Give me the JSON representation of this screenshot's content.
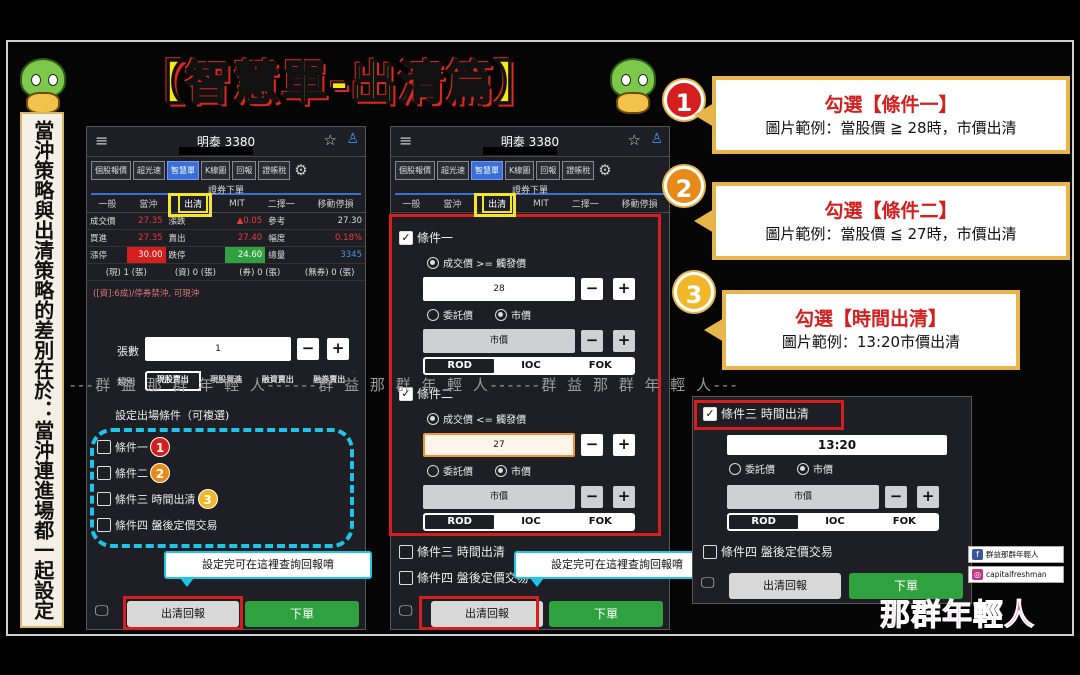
{
  "banner": {
    "title": "【智慧單-出清篇】"
  },
  "left_caption": "當沖策略與出清策略的差別在於：當沖連進場都一起設定",
  "watermark": "---群 益 那 群 年 輕 人------群 益 那 群 年 輕 人------群 益 那 群 年 輕 人---",
  "phone1": {
    "title": "明泰 3380",
    "tabs": [
      "個股報價",
      "超光速",
      "智慧單",
      "K線圖",
      "回報",
      "證帳稅"
    ],
    "section_title": "證券下單",
    "subtabs": [
      "一般",
      "當沖",
      "出清",
      "MIT",
      "二擇一",
      "移動停損"
    ],
    "quote_rows": [
      [
        "成交價",
        "27.35",
        "漲跌",
        "▲0.05",
        "參考",
        "27.30"
      ],
      [
        "買進",
        "27.35",
        "賣出",
        "27.40",
        "幅度",
        "0.18%"
      ],
      [
        "漲停",
        "30.00",
        "跌停",
        "24.60",
        "總量",
        "3345"
      ]
    ],
    "stock_row": [
      "(現) 1 (張)",
      "(資) 0 (張)",
      "(券) 0 (張)",
      "(無券) 0 (張)"
    ],
    "note": "([資]:6成)/停券禁沖, 可現沖",
    "qty_label": "張數",
    "qty_value": "1",
    "trade_label": "類別",
    "trade_options": [
      "現股賣出",
      "現股買進",
      "融資賣出",
      "融券賣出"
    ],
    "conditions_title": "設定出場條件（可複選)",
    "conditions": [
      "條件一",
      "條件二",
      "條件三 時間出清",
      "條件四 盤後定價交易"
    ],
    "badges": [
      "1",
      "2",
      "3"
    ],
    "tip": "設定完可在這裡查詢回報唷",
    "report_btn": "出清回報",
    "order_btn": "下單"
  },
  "phone2": {
    "title": "明泰 3380",
    "tabs": [
      "個股報價",
      "超光速",
      "智慧單",
      "K線圖",
      "回報",
      "證帳稅"
    ],
    "section_title": "證券下單",
    "subtabs": [
      "一般",
      "當沖",
      "出清",
      "MIT",
      "二擇一",
      "移動停損"
    ],
    "cond1_label": "條件一",
    "cond1_trigger": "成交價 >= 觸發價",
    "cond1_price": "28",
    "cond2_label": "條件二",
    "cond2_trigger": "成交價 <= 觸發價",
    "cond2_price": "27",
    "order_type_limit": "委託價",
    "order_type_market": "市價",
    "market_value": "市價",
    "seg": [
      "ROD",
      "IOC",
      "FOK"
    ],
    "cond3_label": "條件三 時間出清",
    "cond4_label": "條件四 盤後定價交易",
    "tip": "設定完可在這裡查詢回報唷",
    "report_btn": "出清回報",
    "order_btn": "下單"
  },
  "phone3": {
    "cond3_label": "條件三 時間出清",
    "time_value": "13:20",
    "order_type_limit": "委託價",
    "order_type_market": "市價",
    "market_value": "市價",
    "seg": [
      "ROD",
      "IOC",
      "FOK"
    ],
    "cond4_label": "條件四 盤後定價交易",
    "report_btn": "出清回報",
    "order_btn": "下單"
  },
  "callouts": [
    {
      "num": "1",
      "title": "勾選【條件一】",
      "sub": "圖片範例：當股價 ≧ 28時，市價出清"
    },
    {
      "num": "2",
      "title": "勾選【條件二】",
      "sub": "圖片範例：當股價 ≦ 27時，市價出清"
    },
    {
      "num": "3",
      "title": "勾選【時間出清】",
      "sub": "圖片範例：13:20市價出清"
    }
  ],
  "social": {
    "fb": "群益那群年輕人",
    "ig": "capitalfreshman"
  },
  "brand": "那群年輕人",
  "colors": {
    "accent_red": "#d61e1e",
    "accent_yellow": "#f4e52a",
    "accent_cyan": "#1ec5e8",
    "order_green": "#2fa23f"
  }
}
